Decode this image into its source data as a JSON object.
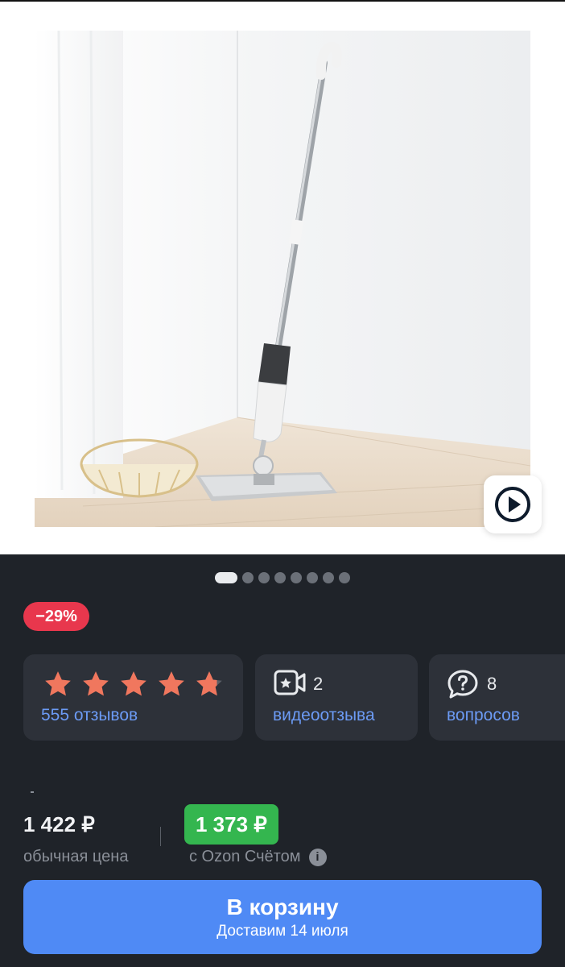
{
  "gallery": {
    "dots_total": 8,
    "active_dot": 0
  },
  "badge": {
    "discount": "−29%"
  },
  "rating_card": {
    "stars": 5,
    "rating": 4.8,
    "reviews_link": "555 отзывов"
  },
  "video_card": {
    "count": "2",
    "link": "видеоотзыва"
  },
  "questions_card": {
    "count": "8",
    "link": "вопросов"
  },
  "price": {
    "regular": "1 422 ₽",
    "regular_label": "обычная цена",
    "ozon": "1 373 ₽",
    "ozon_label": "с Ozon Счётом"
  },
  "cart_button": {
    "label": "В корзину",
    "delivery": "Доставим 14 июля"
  },
  "colors": {
    "background": "#1f2329",
    "card": "#2d3139",
    "accent_blue": "#4f8af5",
    "link_blue": "#6c9bf5",
    "discount_red": "#e8374d",
    "ozon_green": "#34b64f",
    "star": "#f0775e"
  }
}
